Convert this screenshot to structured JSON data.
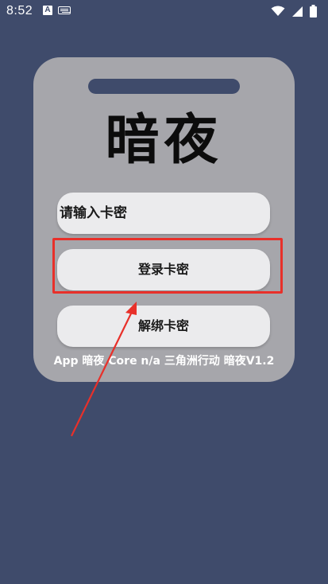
{
  "status_bar": {
    "time": "8:52",
    "icons": [
      "a-notification-icon",
      "keyboard-icon",
      "wifi-icon",
      "cellular-signal-icon",
      "battery-icon"
    ]
  },
  "card": {
    "title": "暗夜",
    "input": {
      "placeholder": "请输入卡密",
      "value": ""
    },
    "login_label": "登录卡密",
    "unbind_label": "解绑卡密",
    "footer": "App 暗夜 Core n/a 三角洲行动 暗夜V1.2"
  },
  "colors": {
    "background": "#3f4b6b",
    "card": "#a6a6ab",
    "pill": "#ebebed",
    "annotation": "#e8302a"
  }
}
